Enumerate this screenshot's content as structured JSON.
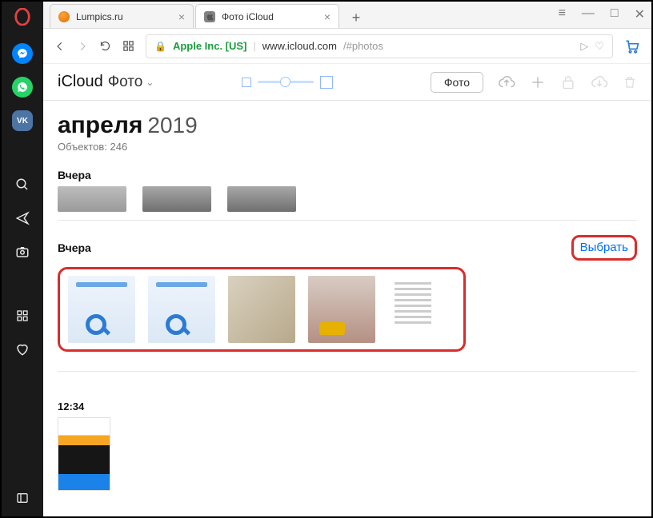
{
  "window": {
    "menu_icon": "≡",
    "minimize": "—",
    "maximize": "□",
    "close": "✕"
  },
  "tabs": [
    {
      "title": "Lumpics.ru",
      "active": false
    },
    {
      "title": "Фото iCloud",
      "active": true
    }
  ],
  "new_tab_label": "+",
  "addressbar": {
    "secure_badge": "Apple Inc. [US]",
    "host": "www.icloud.com",
    "path": "/#photos"
  },
  "icloud_header": {
    "brand": "iCloud",
    "section": "Фото",
    "pill_button": "Фото"
  },
  "page": {
    "month": "апреля",
    "year": "2019",
    "object_count_label": "Объектов: 246"
  },
  "groups": {
    "g1_label": "Вчера",
    "g2_label": "Вчера",
    "select_action": "Выбрать",
    "g3_time": "12:34"
  }
}
